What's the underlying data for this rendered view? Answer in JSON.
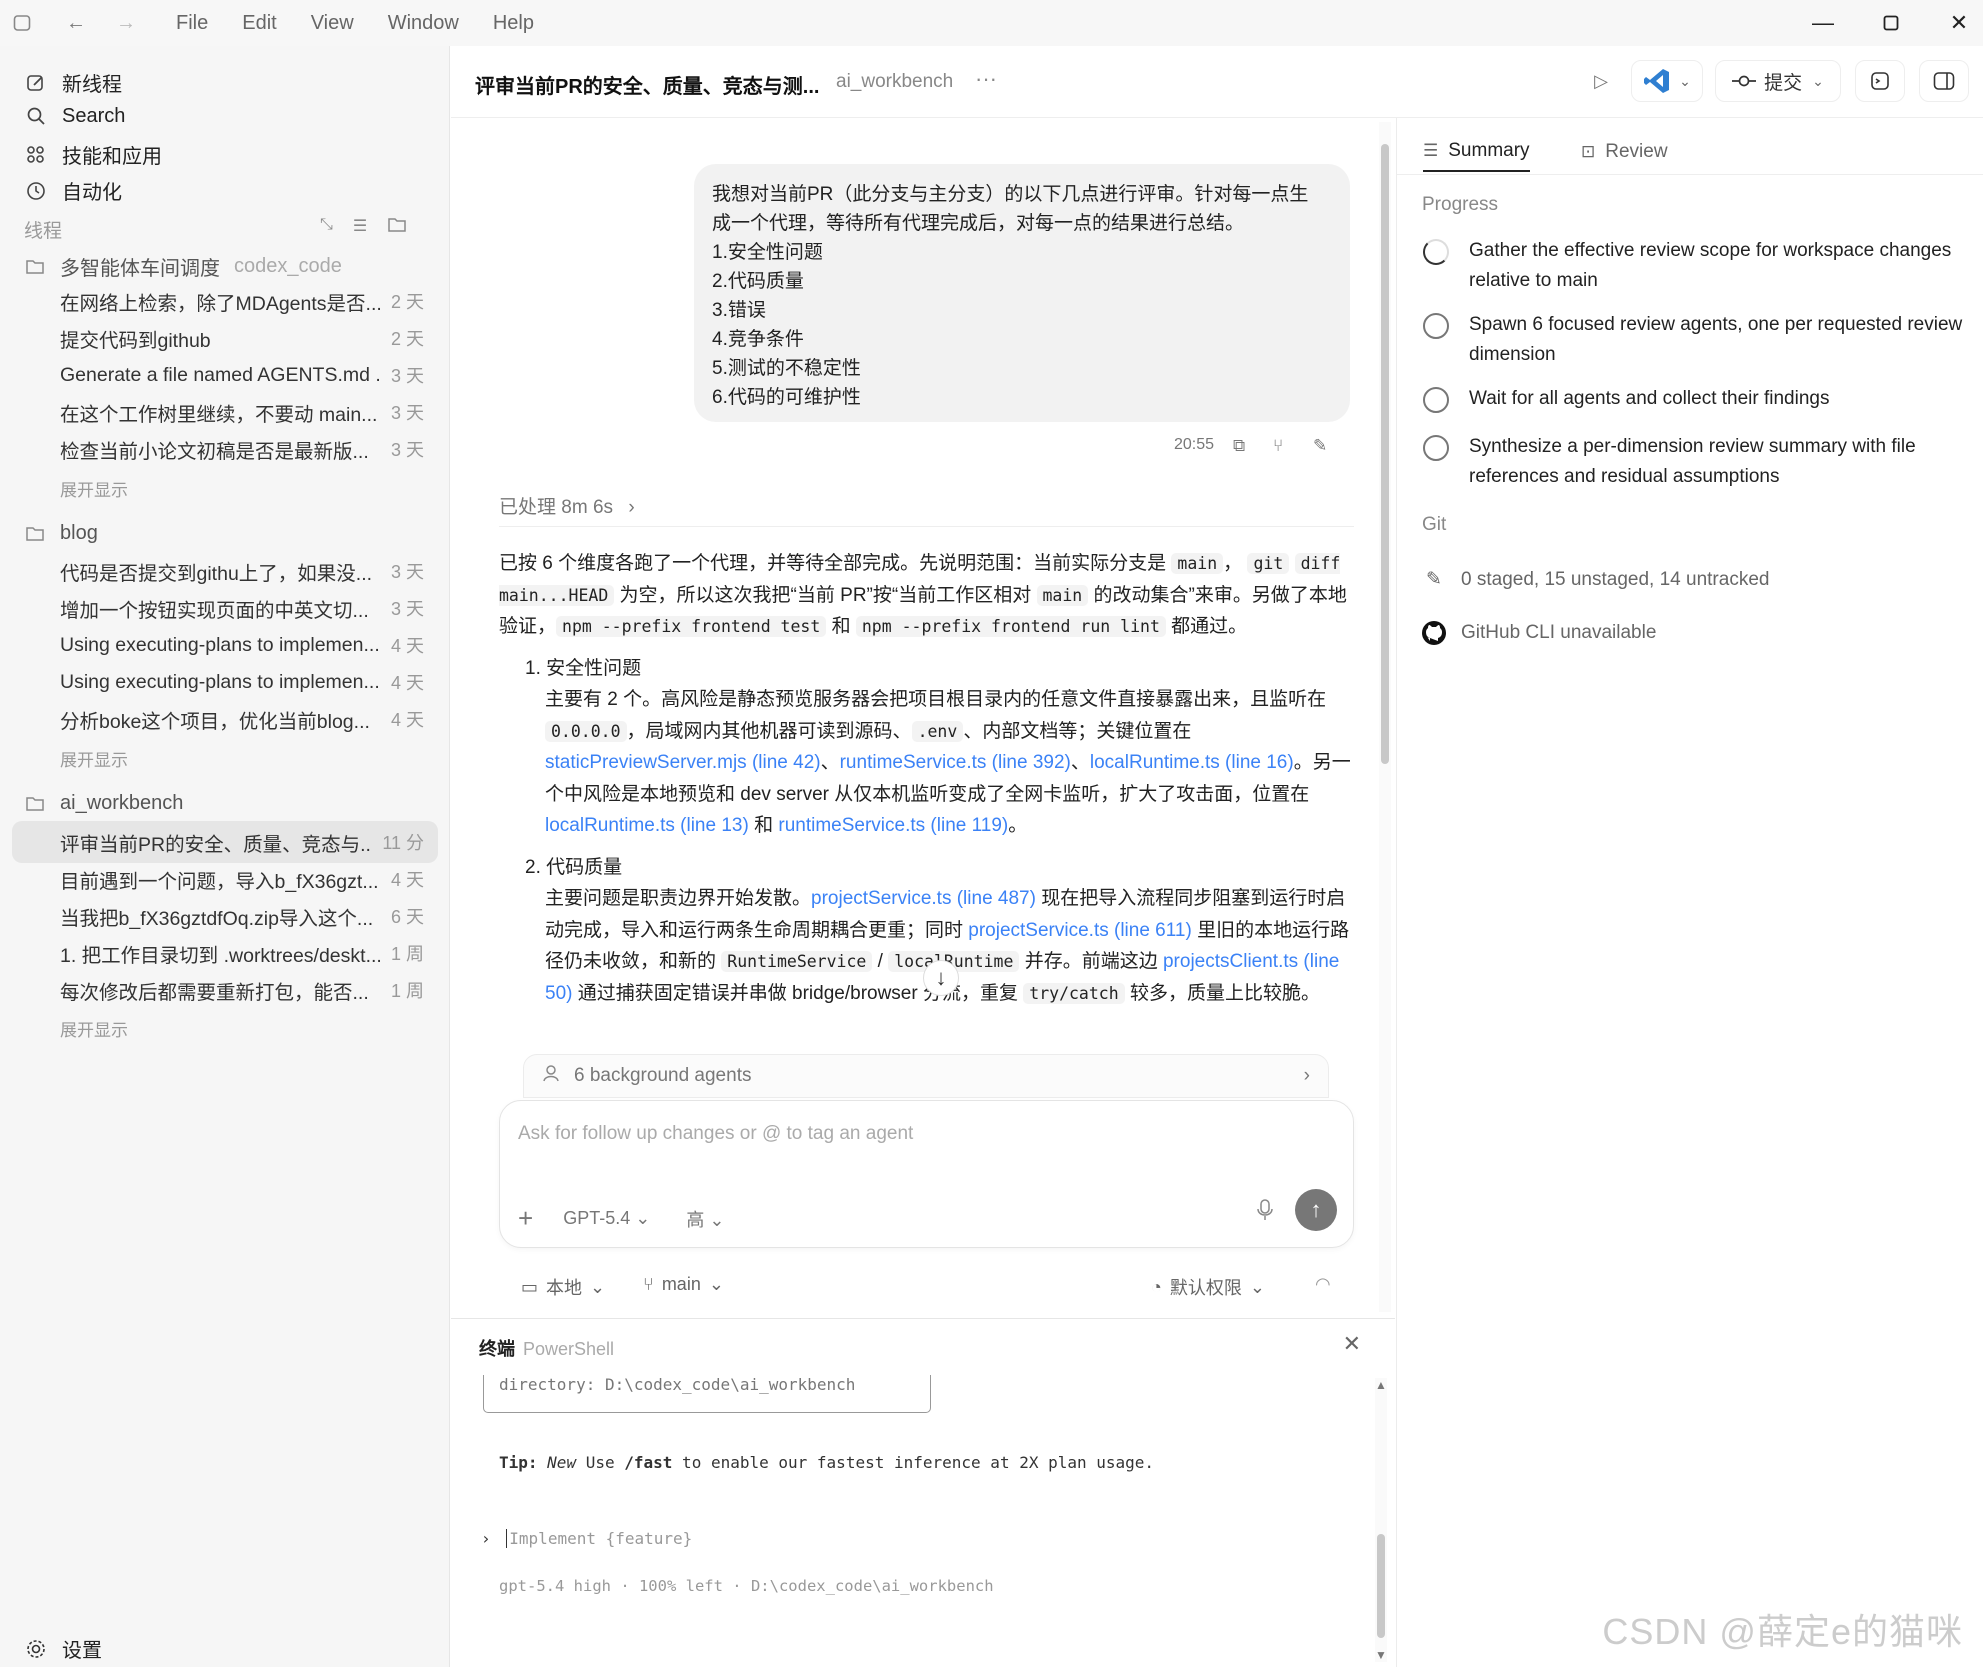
{
  "menu": [
    "File",
    "Edit",
    "View",
    "Window",
    "Help"
  ],
  "sidebar": {
    "nav": [
      {
        "label": "新线程",
        "icon": "edit-icon"
      },
      {
        "label": "Search",
        "icon": "search-icon"
      },
      {
        "label": "技能和应用",
        "icon": "apps-icon"
      },
      {
        "label": "自动化",
        "icon": "clock-icon"
      }
    ],
    "threads_label": "线程",
    "projects": [
      {
        "name": "多智能体车间调度",
        "sub": "codex_code",
        "threads": [
          {
            "title": "在网络上检索，除了MDAgents是否...",
            "age": "2 天"
          },
          {
            "title": "提交代码到github",
            "age": "2 天"
          },
          {
            "title": "Generate a file named AGENTS.md ...",
            "age": "3 天"
          },
          {
            "title": "在这个工作树里继续，不要动 main...",
            "age": "3 天"
          },
          {
            "title": "检查当前小论文初稿是否是最新版...",
            "age": "3 天"
          }
        ]
      },
      {
        "name": "blog",
        "sub": "",
        "threads": [
          {
            "title": "代码是否提交到githu上了，如果没...",
            "age": "3 天"
          },
          {
            "title": "增加一个按钮实现页面的中英文切...",
            "age": "3 天"
          },
          {
            "title": "Using executing-plans to implemen...",
            "age": "4 天"
          },
          {
            "title": "Using executing-plans to implemen...",
            "age": "4 天"
          },
          {
            "title": "分析boke这个项目，优化当前blog...",
            "age": "4 天"
          }
        ]
      },
      {
        "name": "ai_workbench",
        "sub": "",
        "threads": [
          {
            "title": "评审当前PR的安全、质量、竞态与...",
            "age": "11 分"
          },
          {
            "title": "目前遇到一个问题，导入b_fX36gzt...",
            "age": "4 天"
          },
          {
            "title": "当我把b_fX36gztdfOq.zip导入这个...",
            "age": "6 天"
          },
          {
            "title": "1. 把工作目录切到 .worktrees/deskt...",
            "age": "1 周"
          },
          {
            "title": "每次修改后都需要重新打包，能否...",
            "age": "1 周"
          }
        ]
      }
    ],
    "expand_label": "展开显示",
    "settings_label": "设置"
  },
  "header": {
    "title": "评审当前PR的安全、质量、竞态与测...",
    "project": "ai_workbench",
    "more": "···",
    "commit_label": "提交"
  },
  "chat": {
    "user_message": [
      "我想对当前PR（此分支与主分支）的以下几点进行评审。针对每一点生",
      "成一个代理，等待所有代理完成后，对每一点的结果进行总结。",
      "1.安全性问题",
      "2.代码质量",
      "3.错误",
      "4.竞争条件",
      "5.测试的不稳定性",
      "6.代码的可维护性"
    ],
    "time": "20:55",
    "processed": "已处理 8m 6s",
    "answer": {
      "intro_1": "已按 6 个维度各跑了一个代理，并等待全部完成。先说明范围：当前实际分支是",
      "code_main": "main",
      "sep_1": "，",
      "code_git": "git",
      "code_diff": "diff main...HEAD",
      "intro_2": " 为空，所以这次我把“当前 PR”按“当前工作区相对 ",
      "code_main2": "main",
      "intro_3": " 的改动集合”来审。另做了本地验证，",
      "code_test": "npm --prefix frontend test",
      "and": " 和 ",
      "code_lint": "npm --prefix frontend run lint",
      "intro_4": " 都通过。",
      "item1_head": "1. 安全性问题",
      "item1_a": "主要有 2 个。高风险是静态预览服务器会把项目根目录内的任意文件直接暴露出来，且监听在",
      "code_ip": "0.0.0.0",
      "item1_b": "，局域网内其他机器可读到源码、",
      "code_env": ".env",
      "item1_c": "、内部文档等；关键位置在",
      "link_1": "staticPreviewServer.mjs (line 42)",
      "comma": "、",
      "link_2": "runtimeService.ts (line 392)",
      "link_3": "localRuntime.ts (line 16)",
      "item1_d": "。另一个中风险是本地预览和 dev server 从仅本机监听变成了全网卡监听，扩大了攻击面，位置在",
      "link_4": "localRuntime.ts (line 13)",
      "and_zh": " 和 ",
      "link_5": "runtimeService.ts (line 119)",
      "period": "。",
      "item2_head": "2. 代码质量",
      "item2_a": "主要问题是职责边界开始发散。",
      "link_6": "projectService.ts (line 487)",
      "item2_b": " 现在把导入流程同步阻塞到运行时启动完成，导入和运行两条生命周期耦合更重；同时 ",
      "link_7": "projectService.ts (line 611)",
      "item2_c": " 里旧的本地运行路径仍未收敛，和新的 ",
      "code_rs": "RuntimeService",
      "slash": " / ",
      "code_lr": "localRuntime",
      "item2_d": " 并存。前端这边",
      "link_8": "projectsClient.ts (line 50)",
      "item2_e": " 通过捕获固定错误并串做 bridge/browser 分流，重复",
      "code_tc": "try/catch",
      "item2_f": " 较多，质量上比较脆。"
    },
    "bg_agents": "6 background agents",
    "composer_placeholder": "Ask for follow up changes or @ to tag an agent",
    "model": "GPT-5.4",
    "effort": "高",
    "footer_local": "本地",
    "footer_branch": "main",
    "footer_perm": "默认权限"
  },
  "terminal": {
    "title": "终端",
    "shell": "PowerShell",
    "dir_line": "directory: D:\\codex_code\\ai_workbench",
    "tip_label": "Tip:",
    "tip_new": "New",
    "tip_use": " Use ",
    "tip_cmd": "/fast",
    "tip_rest": " to enable our fastest inference at 2X plan usage.",
    "prompt_placeholder": "Implement {feature}",
    "status": "gpt-5.4 high · 100% left · D:\\codex_code\\ai_workbench"
  },
  "right": {
    "tabs": [
      "Summary",
      "Review"
    ],
    "progress_label": "Progress",
    "progress": [
      {
        "text": "Gather the effective review scope for workspace changes relative to main",
        "state": "in-progress"
      },
      {
        "text": "Spawn 6 focused review agents, one per requested review dimension",
        "state": "pending"
      },
      {
        "text": "Wait for all agents and collect their findings",
        "state": "pending"
      },
      {
        "text": "Synthesize a per-dimension review summary with file references and residual assumptions",
        "state": "pending"
      }
    ],
    "git_label": "Git",
    "git_status": "0 staged, 15 unstaged, 14 untracked",
    "github": "GitHub CLI unavailable"
  },
  "watermark": "CSDN @薛定e的猫咪",
  "colors": {
    "link": "#3b82f6",
    "sidebar_bg": "#f6f6f6",
    "active_thread": "#e6e6e6",
    "vscode_blue": "#2f7fd1"
  }
}
